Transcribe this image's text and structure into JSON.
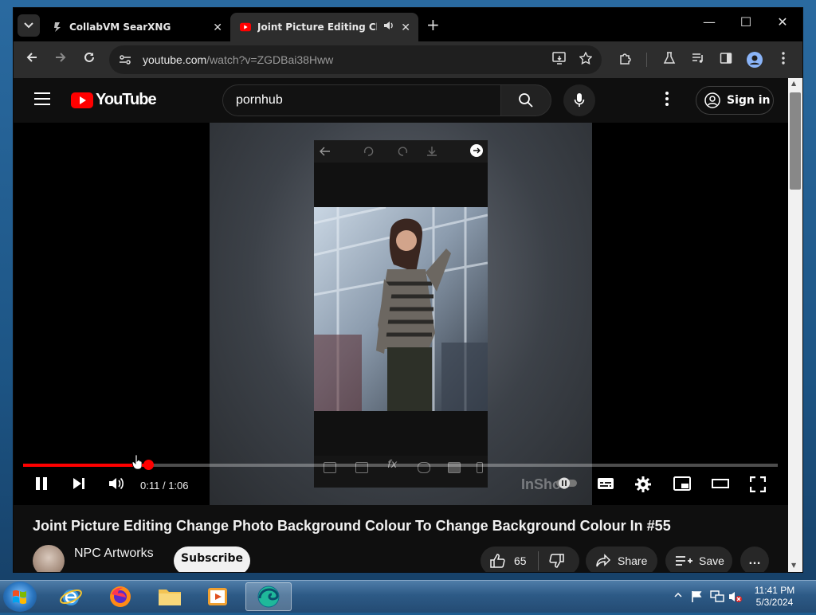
{
  "browser": {
    "tabs": [
      {
        "title": "CollabVM SearXNG",
        "close": "✕"
      },
      {
        "title": "Joint Picture Editing Chang",
        "close": "✕"
      }
    ],
    "new_tab": "+",
    "window_controls": {
      "minimize": "—",
      "maximize": "☐",
      "close": "✕"
    },
    "url_host": "youtube.com",
    "url_path": "/watch?v=ZGDBai38Hww"
  },
  "youtube": {
    "logo_text": "YouTube",
    "search_query": "pornhub",
    "sign_in": "Sign in"
  },
  "player": {
    "current_time": "0:11",
    "duration": "1:06",
    "progress_fraction": 0.166,
    "watermark": "InShot"
  },
  "video": {
    "title": "Joint Picture Editing Change Photo Background Colour To Change Background Colour In #55",
    "channel": "NPC Artworks",
    "subscribe": "Subscribe",
    "likes": "65",
    "share": "Share",
    "save": "Save",
    "more": "…"
  },
  "taskbar": {
    "time": "11:41 PM",
    "date": "5/3/2024"
  },
  "colors": {
    "accent_red": "#ff0000",
    "yt_bg": "#0f0f0f"
  }
}
